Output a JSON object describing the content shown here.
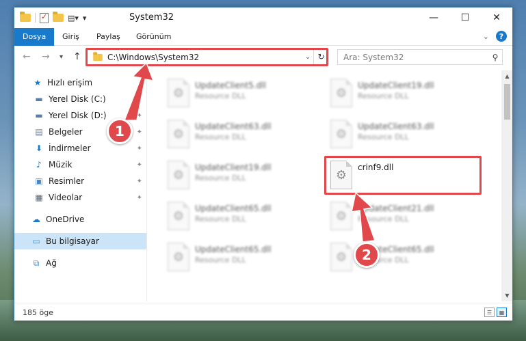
{
  "window": {
    "title": "System32",
    "controls": {
      "minimize": "—",
      "maximize": "☐",
      "close": "✕"
    }
  },
  "ribbon": {
    "tabs": [
      "Dosya",
      "Giriş",
      "Paylaş",
      "Görünüm"
    ],
    "help": "?"
  },
  "nav": {
    "back": "←",
    "forward": "→",
    "recent": "▾",
    "up": "↑",
    "address": "C:\\Windows\\System32",
    "refresh": "↻",
    "search_placeholder": "Ara: System32"
  },
  "sidebar": {
    "items": [
      {
        "label": "Hızlı erişim",
        "icon": "star-icon",
        "glyph": "★",
        "color": "#1979ca"
      },
      {
        "label": "Yerel Disk (C:)",
        "icon": "drive-icon",
        "glyph": "▬",
        "color": "#5a7ea6",
        "pinned": true
      },
      {
        "label": "Yerel Disk (D:)",
        "icon": "drive-icon",
        "glyph": "▬",
        "color": "#5a7ea6",
        "pinned": true
      },
      {
        "label": "Belgeler",
        "icon": "documents-icon",
        "glyph": "▤",
        "color": "#6b7f95",
        "pinned": true
      },
      {
        "label": "İndirmeler",
        "icon": "download-icon",
        "glyph": "⬇",
        "color": "#1979ca",
        "pinned": true
      },
      {
        "label": "Müzik",
        "icon": "music-icon",
        "glyph": "♪",
        "color": "#1979ca",
        "pinned": true
      },
      {
        "label": "Resimler",
        "icon": "pictures-icon",
        "glyph": "▣",
        "color": "#4a8ac0",
        "pinned": true
      },
      {
        "label": "Videolar",
        "icon": "videos-icon",
        "glyph": "▦",
        "color": "#5a6a7a",
        "pinned": true
      },
      {
        "label": "OneDrive",
        "icon": "cloud-icon",
        "glyph": "☁",
        "color": "#1979ca"
      },
      {
        "label": "Bu bilgisayar",
        "icon": "computer-icon",
        "glyph": "▭",
        "color": "#3a8fd6",
        "selected": true
      },
      {
        "label": "Ağ",
        "icon": "network-icon",
        "glyph": "⧉",
        "color": "#3a8fd6"
      }
    ],
    "pin_glyph": "📌"
  },
  "files": [
    {
      "name": "UpdateClient5.dll",
      "type": "Resource DLL",
      "blurred": true
    },
    {
      "name": "UpdateClient19.dll",
      "type": "Resource DLL",
      "blurred": true
    },
    {
      "name": "UpdateClient63.dll",
      "type": "Resource DLL",
      "blurred": true
    },
    {
      "name": "UpdateClient63.dll",
      "type": "Resource DLL",
      "blurred": true
    },
    {
      "name": "UpdateClient19.dll",
      "type": "Resource DLL",
      "blurred": true
    },
    {
      "name": "crinf9.dll",
      "type": "",
      "blurred": false
    },
    {
      "name": "UpdateClient65.dll",
      "type": "Resource DLL",
      "blurred": true
    },
    {
      "name": "UpdateClient21.dll",
      "type": "Resource DLL",
      "blurred": true
    },
    {
      "name": "UpdateClient65.dll",
      "type": "Resource DLL",
      "blurred": true
    },
    {
      "name": "UpdateClient65.dll",
      "type": "Resource DLL",
      "blurred": true
    }
  ],
  "status": {
    "count": "185 öge"
  },
  "annotations": {
    "badge1": "1",
    "badge2": "2",
    "color": "#e0484b"
  }
}
